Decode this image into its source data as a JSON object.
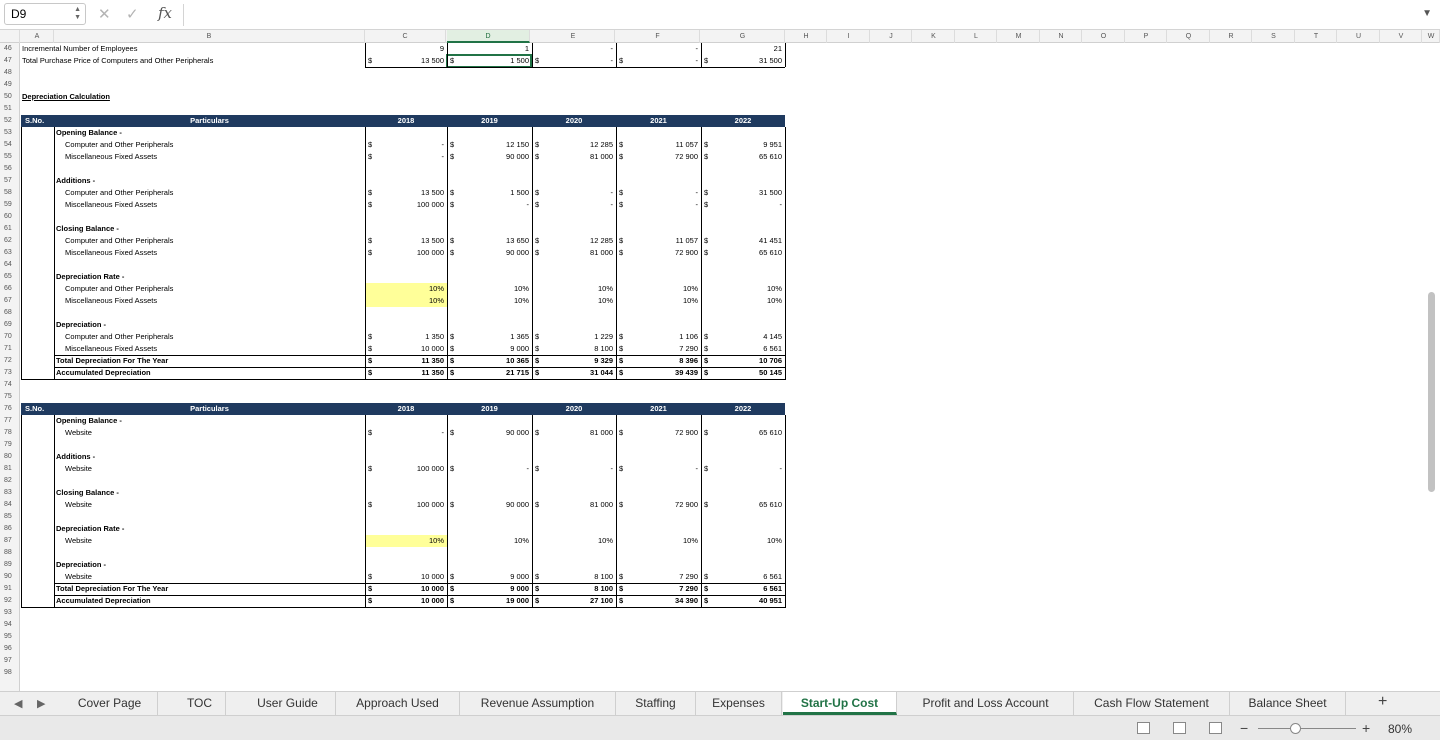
{
  "formula_bar": {
    "name_box": "D9",
    "formula": "",
    "fx_label": "fx",
    "cancel_icon": "✕",
    "enter_icon": "✓"
  },
  "columns": [
    "A",
    "B",
    "C",
    "D",
    "E",
    "F",
    "G",
    "H",
    "I",
    "J",
    "K",
    "L",
    "M",
    "N",
    "O",
    "P",
    "Q",
    "R",
    "S",
    "T",
    "U",
    "V",
    "W"
  ],
  "rows_visible": [
    "46",
    "47",
    "48",
    "49",
    "50",
    "51",
    "52",
    "53",
    "54",
    "55",
    "56",
    "57",
    "58",
    "59",
    "60",
    "61",
    "62",
    "63",
    "64",
    "65",
    "66",
    "67",
    "68",
    "69",
    "70",
    "71",
    "72",
    "73",
    "74",
    "75",
    "76",
    "77",
    "78",
    "79",
    "80",
    "81",
    "82",
    "83",
    "84",
    "85",
    "86",
    "87",
    "88",
    "89",
    "90",
    "91",
    "92",
    "93",
    "94",
    "95",
    "96",
    "97",
    "98"
  ],
  "top_rows": [
    {
      "label": "Incremental Number of Employees",
      "values": [
        "9",
        "1",
        "-",
        "-",
        "21"
      ],
      "dollar": false
    },
    {
      "label": "Total Purchase Price of Computers and Other Peripherals",
      "values": [
        "13 500",
        "1 500",
        "-",
        "-",
        "31 500"
      ],
      "dollar": true
    }
  ],
  "currency_symbol": "$",
  "section_title": "Depreciation Calculation",
  "table_headers": {
    "sno": "S.No.",
    "particulars": "Particulars",
    "years": [
      "2018",
      "2019",
      "2020",
      "2021",
      "2022"
    ]
  },
  "table1": [
    {
      "text": "Opening Balance -",
      "kind": "group"
    },
    {
      "text": "Computer and Other Peripherals",
      "kind": "item",
      "values": [
        "-",
        "12 150",
        "12 285",
        "11 057",
        "9 951"
      ],
      "dollar": true
    },
    {
      "text": "Miscellaneous Fixed Assets",
      "kind": "item",
      "values": [
        "-",
        "90 000",
        "81 000",
        "72 900",
        "65 610"
      ],
      "dollar": true
    },
    {
      "text": "",
      "kind": "blank"
    },
    {
      "text": "Additions -",
      "kind": "group"
    },
    {
      "text": "Computer and Other Peripherals",
      "kind": "item",
      "values": [
        "13 500",
        "1 500",
        "-",
        "-",
        "31 500"
      ],
      "dollar": true
    },
    {
      "text": "Miscellaneous Fixed Assets",
      "kind": "item",
      "values": [
        "100 000",
        "-",
        "-",
        "-",
        "-"
      ],
      "dollar": true
    },
    {
      "text": "",
      "kind": "blank"
    },
    {
      "text": "Closing Balance -",
      "kind": "group"
    },
    {
      "text": "Computer and Other Peripherals",
      "kind": "item",
      "values": [
        "13 500",
        "13 650",
        "12 285",
        "11 057",
        "41 451"
      ],
      "dollar": true
    },
    {
      "text": "Miscellaneous Fixed Assets",
      "kind": "item",
      "values": [
        "100 000",
        "90 000",
        "81 000",
        "72 900",
        "65 610"
      ],
      "dollar": true
    },
    {
      "text": "",
      "kind": "blank"
    },
    {
      "text": "Depreciation Rate -",
      "kind": "group"
    },
    {
      "text": "Computer and Other Peripherals",
      "kind": "item",
      "values": [
        "10%",
        "10%",
        "10%",
        "10%",
        "10%"
      ],
      "dollar": false,
      "highlight_first": true
    },
    {
      "text": "Miscellaneous Fixed Assets",
      "kind": "item",
      "values": [
        "10%",
        "10%",
        "10%",
        "10%",
        "10%"
      ],
      "dollar": false,
      "highlight_first": true
    },
    {
      "text": "",
      "kind": "blank"
    },
    {
      "text": "Depreciation -",
      "kind": "group"
    },
    {
      "text": "Computer and Other Peripherals",
      "kind": "item",
      "values": [
        "1 350",
        "1 365",
        "1 229",
        "1 106",
        "4 145"
      ],
      "dollar": true
    },
    {
      "text": "Miscellaneous Fixed Assets",
      "kind": "item",
      "values": [
        "10 000",
        "9 000",
        "8 100",
        "7 290",
        "6 561"
      ],
      "dollar": true
    },
    {
      "text": "Total Depreciation For The Year",
      "kind": "total",
      "values": [
        "11 350",
        "10 365",
        "9 329",
        "8 396",
        "10 706"
      ],
      "dollar": true
    },
    {
      "text": "Accumulated Depreciation",
      "kind": "total",
      "values": [
        "11 350",
        "21 715",
        "31 044",
        "39 439",
        "50 145"
      ],
      "dollar": true
    }
  ],
  "table2": [
    {
      "text": "Opening Balance -",
      "kind": "group"
    },
    {
      "text": "Website",
      "kind": "item",
      "values": [
        "-",
        "90 000",
        "81 000",
        "72 900",
        "65 610"
      ],
      "dollar": true
    },
    {
      "text": "",
      "kind": "blank"
    },
    {
      "text": "Additions -",
      "kind": "group"
    },
    {
      "text": "Website",
      "kind": "item",
      "values": [
        "100 000",
        "-",
        "-",
        "-",
        "-"
      ],
      "dollar": true
    },
    {
      "text": "",
      "kind": "blank"
    },
    {
      "text": "Closing Balance -",
      "kind": "group"
    },
    {
      "text": "Website",
      "kind": "item",
      "values": [
        "100 000",
        "90 000",
        "81 000",
        "72 900",
        "65 610"
      ],
      "dollar": true
    },
    {
      "text": "",
      "kind": "blank"
    },
    {
      "text": "Depreciation Rate -",
      "kind": "group"
    },
    {
      "text": "Website",
      "kind": "item",
      "values": [
        "10%",
        "10%",
        "10%",
        "10%",
        "10%"
      ],
      "dollar": false,
      "highlight_first": true
    },
    {
      "text": "",
      "kind": "blank"
    },
    {
      "text": "Depreciation -",
      "kind": "group"
    },
    {
      "text": "Website",
      "kind": "item",
      "values": [
        "10 000",
        "9 000",
        "8 100",
        "7 290",
        "6 561"
      ],
      "dollar": true
    },
    {
      "text": "Total Depreciation For The Year",
      "kind": "total",
      "values": [
        "10 000",
        "9 000",
        "8 100",
        "7 290",
        "6 561"
      ],
      "dollar": true
    },
    {
      "text": "Accumulated Depreciation",
      "kind": "total",
      "values": [
        "10 000",
        "19 000",
        "27 100",
        "34 390",
        "40 951"
      ],
      "dollar": true
    }
  ],
  "sheet_tabs": [
    {
      "label": "Cover Page",
      "active": false
    },
    {
      "label": "TOC",
      "active": false
    },
    {
      "label": "User Guide",
      "active": false
    },
    {
      "label": "Approach Used",
      "active": false
    },
    {
      "label": "Revenue Assumption",
      "active": false
    },
    {
      "label": "Staffing",
      "active": false
    },
    {
      "label": "Expenses",
      "active": false
    },
    {
      "label": "Start-Up Cost",
      "active": true
    },
    {
      "label": "Profit and Loss Account",
      "active": false
    },
    {
      "label": "Cash Flow Statement",
      "active": false
    },
    {
      "label": "Balance Sheet",
      "active": false
    }
  ],
  "add_sheet_label": "+",
  "status": {
    "zoom": "80%",
    "zoom_minus": "−",
    "zoom_plus": "+"
  },
  "colors": {
    "header_fill": "#1f3a5f",
    "input_highlight": "#ffff99",
    "active_tab": "#217346"
  }
}
